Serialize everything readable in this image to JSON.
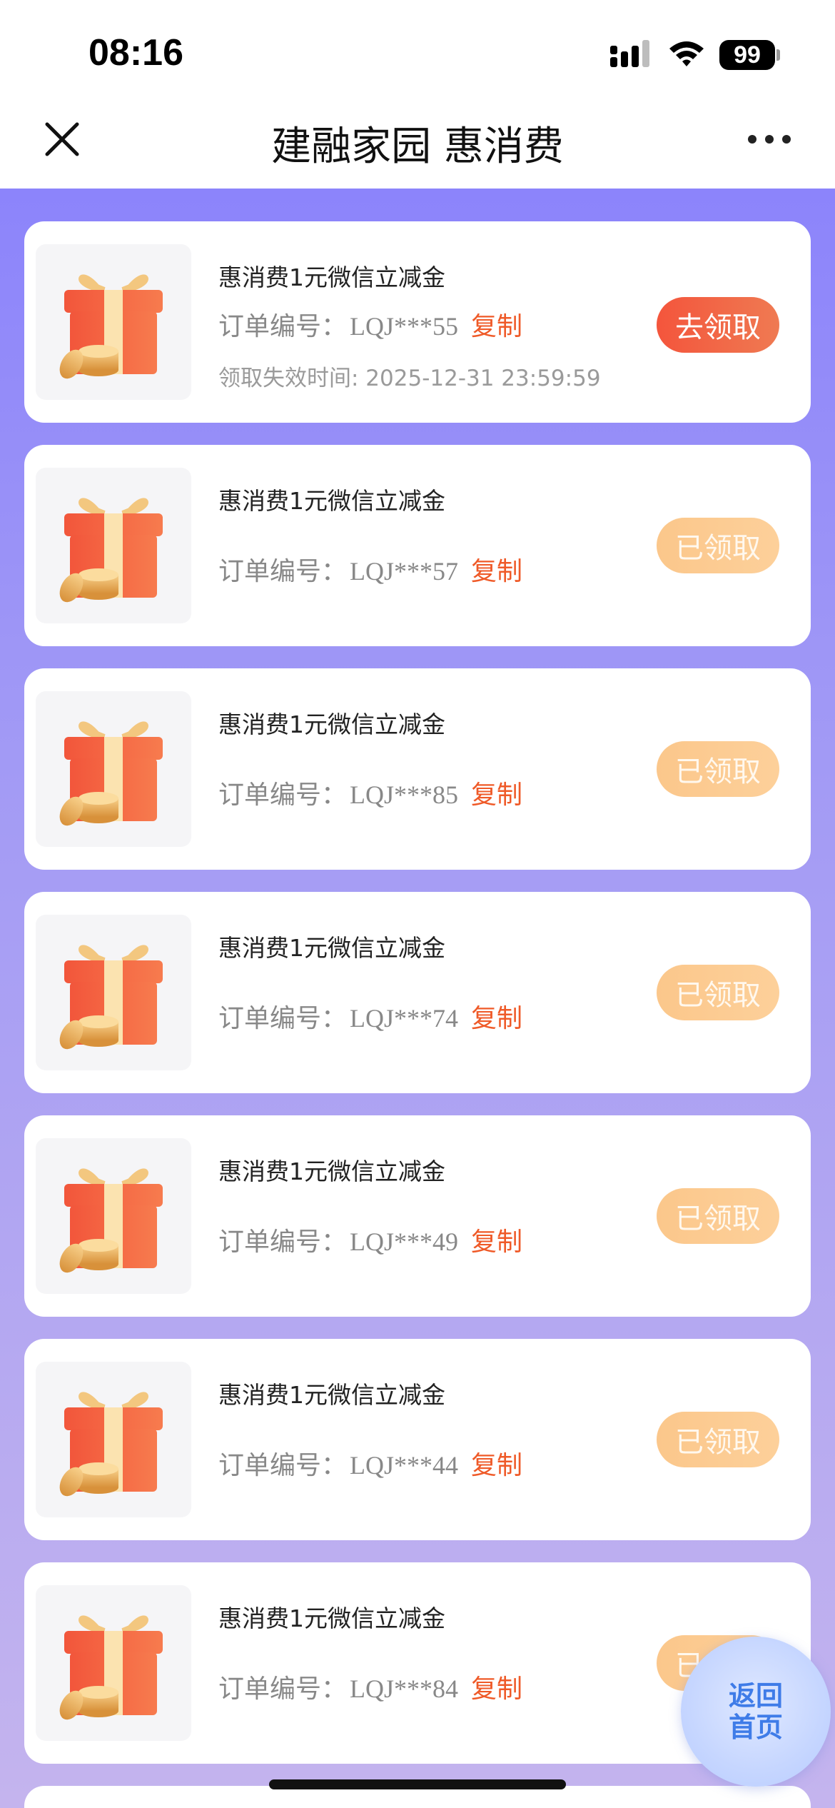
{
  "status_bar": {
    "time": "08:16",
    "battery": "99"
  },
  "nav": {
    "title": "建融家园 惠消费"
  },
  "coupons": [
    {
      "title": "惠消费1元微信立减金",
      "order_label": "订单编号：",
      "order_value": "LQJ***55",
      "copy_label": "复制",
      "expire_text": "领取失效时间: 2025-12-31 23:59:59",
      "button_label": "去领取",
      "status": "unclaimed"
    },
    {
      "title": "惠消费1元微信立减金",
      "order_label": "订单编号：",
      "order_value": "LQJ***57",
      "copy_label": "复制",
      "button_label": "已领取",
      "status": "claimed"
    },
    {
      "title": "惠消费1元微信立减金",
      "order_label": "订单编号：",
      "order_value": "LQJ***85",
      "copy_label": "复制",
      "button_label": "已领取",
      "status": "claimed"
    },
    {
      "title": "惠消费1元微信立减金",
      "order_label": "订单编号：",
      "order_value": "LQJ***74",
      "copy_label": "复制",
      "button_label": "已领取",
      "status": "claimed"
    },
    {
      "title": "惠消费1元微信立减金",
      "order_label": "订单编号：",
      "order_value": "LQJ***49",
      "copy_label": "复制",
      "button_label": "已领取",
      "status": "claimed"
    },
    {
      "title": "惠消费1元微信立减金",
      "order_label": "订单编号：",
      "order_value": "LQJ***44",
      "copy_label": "复制",
      "button_label": "已领取",
      "status": "claimed"
    },
    {
      "title": "惠消费1元微信立减金",
      "order_label": "订单编号：",
      "order_value": "LQJ***84",
      "copy_label": "复制",
      "button_label": "已领取",
      "status": "claimed"
    }
  ],
  "home_button": {
    "line1": "返回",
    "line2": "首页"
  },
  "colors": {
    "accent": "#ef5a28",
    "bg_top": "#8c84fb",
    "bg_bottom": "#c4b4ee",
    "claimed_btn": "#fbc78b"
  },
  "icons": {
    "close": "close-icon",
    "more": "more-icon",
    "gift": "gift-coins-icon"
  }
}
